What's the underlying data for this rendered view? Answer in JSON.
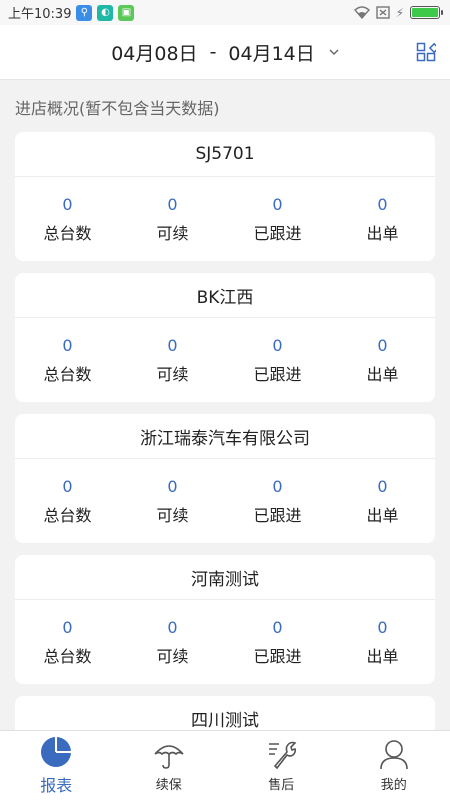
{
  "status_bar": {
    "time": "上午10:39"
  },
  "header": {
    "date_start": "04月08日",
    "separator": "-",
    "date_end": "04月14日"
  },
  "section_title": "进店概况(暂不包含当天数据)",
  "cards": [
    {
      "title": "SJ5701",
      "stats": [
        {
          "value": "0",
          "label": "总台数"
        },
        {
          "value": "0",
          "label": "可续"
        },
        {
          "value": "0",
          "label": "已跟进"
        },
        {
          "value": "0",
          "label": "出单"
        }
      ]
    },
    {
      "title": "BK江西",
      "stats": [
        {
          "value": "0",
          "label": "总台数"
        },
        {
          "value": "0",
          "label": "可续"
        },
        {
          "value": "0",
          "label": "已跟进"
        },
        {
          "value": "0",
          "label": "出单"
        }
      ]
    },
    {
      "title": "浙江瑞泰汽车有限公司",
      "stats": [
        {
          "value": "0",
          "label": "总台数"
        },
        {
          "value": "0",
          "label": "可续"
        },
        {
          "value": "0",
          "label": "已跟进"
        },
        {
          "value": "0",
          "label": "出单"
        }
      ]
    },
    {
      "title": "河南测试",
      "stats": [
        {
          "value": "0",
          "label": "总台数"
        },
        {
          "value": "0",
          "label": "可续"
        },
        {
          "value": "0",
          "label": "已跟进"
        },
        {
          "value": "0",
          "label": "出单"
        }
      ]
    },
    {
      "title": "四川测试",
      "stats": []
    }
  ],
  "bottom_nav": [
    {
      "label": "报表",
      "icon": "pie-chart-icon",
      "active": true
    },
    {
      "label": "续保",
      "icon": "umbrella-icon",
      "active": false
    },
    {
      "label": "售后",
      "icon": "wrench-icon",
      "active": false
    },
    {
      "label": "我的",
      "icon": "user-icon",
      "active": false
    }
  ],
  "colors": {
    "accent": "#3a6bbf",
    "background": "#f2f2f2"
  }
}
